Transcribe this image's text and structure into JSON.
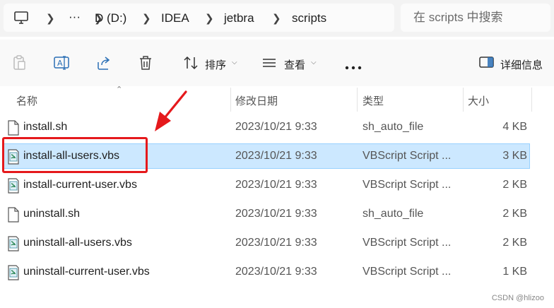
{
  "address": {
    "crumbs": [
      "D (D:)",
      "IDEA",
      "jetbra",
      "scripts"
    ],
    "search_placeholder": "在 scripts 中搜索"
  },
  "toolbar": {
    "sort_label": "排序",
    "view_label": "查看",
    "details_label": "详细信息"
  },
  "columns": {
    "name": "名称",
    "date": "修改日期",
    "type": "类型",
    "size": "大小"
  },
  "files": [
    {
      "name": "install.sh",
      "date": "2023/10/21 9:33",
      "type": "sh_auto_file",
      "size": "4 KB",
      "icon": "blank-file-icon"
    },
    {
      "name": "install-all-users.vbs",
      "date": "2023/10/21 9:33",
      "type": "VBScript Script ...",
      "size": "3 KB",
      "icon": "vbs-script-icon",
      "selected": true
    },
    {
      "name": "install-current-user.vbs",
      "date": "2023/10/21 9:33",
      "type": "VBScript Script ...",
      "size": "2 KB",
      "icon": "vbs-script-icon"
    },
    {
      "name": "uninstall.sh",
      "date": "2023/10/21 9:33",
      "type": "sh_auto_file",
      "size": "2 KB",
      "icon": "blank-file-icon"
    },
    {
      "name": "uninstall-all-users.vbs",
      "date": "2023/10/21 9:33",
      "type": "VBScript Script ...",
      "size": "2 KB",
      "icon": "vbs-script-icon"
    },
    {
      "name": "uninstall-current-user.vbs",
      "date": "2023/10/21 9:33",
      "type": "VBScript Script ...",
      "size": "1 KB",
      "icon": "vbs-script-icon"
    }
  ],
  "watermark": "CSDN @hlizoo",
  "colors": {
    "selection": "#cce8ff",
    "selection_border": "#99d1ff",
    "annotation": "#e5191c"
  }
}
